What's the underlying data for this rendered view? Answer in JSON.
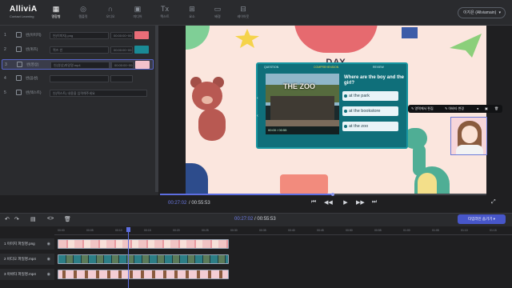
{
  "app": {
    "name": "AlliviA",
    "tagline": "Contact Learning"
  },
  "topnav": {
    "items": [
      {
        "icon": "card-icon",
        "label": "명함형",
        "active": true
      },
      {
        "icon": "shapes-icon",
        "label": "템플릿"
      },
      {
        "icon": "headphones-icon",
        "label": "오디오"
      },
      {
        "icon": "media-icon",
        "label": "미디어"
      },
      {
        "icon": "text-icon",
        "label": "텍스트"
      },
      {
        "icon": "grid-icon",
        "label": "요소"
      },
      {
        "icon": "background-icon",
        "label": "배경"
      },
      {
        "icon": "layout-icon",
        "label": "레이아웃"
      }
    ],
    "user": "이지은 (Allviamain)"
  },
  "scenes": [
    {
      "num": "1",
      "name": "씬(이미지)",
      "file": "씬(이미지).png",
      "file2": "00:00:00~00:00:00"
    },
    {
      "num": "2",
      "name": "씬(퀴즈)",
      "file": "퀴즈 씬",
      "file2": "00:00:00~00:00:00"
    },
    {
      "num": "3",
      "name": "씬(영상)",
      "file": "씬(영상)파일명.mp4",
      "file2": "00:00:00~00:00:55",
      "active": true
    },
    {
      "num": "4",
      "name": "씬(음성)",
      "file": "",
      "file2": ""
    },
    {
      "num": "5",
      "name": "씬(텍스트)",
      "file": "씬(텍스트) 내용을 입력해주세요",
      "file2": ""
    }
  ],
  "canvas": {
    "banner_day": "DAY",
    "quiz": {
      "tabs": [
        "QUESTION",
        "COMPREHENSION",
        "REVIEW"
      ],
      "video_sign": "THE ZOO",
      "video_time": "00:00 / 00:55",
      "question": "Where are the boy and the girl?",
      "answers": [
        "at the park",
        "at the bookstore",
        "at the zoo"
      ]
    },
    "element_toolbar": {
      "edit_label": "✎ 영역에서 편집",
      "replace_label": "✎ 아바타 변경"
    }
  },
  "player": {
    "current": "00:27:02",
    "total": "00:55:53",
    "progress": 0.53
  },
  "timeline": {
    "current": "00:27:02",
    "total": "00:55:53",
    "action_label": "타임라인 숨기기 ▾",
    "ruler": [
      "00:00",
      "00:05",
      "00:10",
      "00:15",
      "00:20",
      "00:25",
      "00:30",
      "00:35",
      "00:40",
      "00:45",
      "00:50",
      "00:55",
      "01:00",
      "01:05",
      "01:10",
      "01:15"
    ],
    "tracks": [
      {
        "label": "1 이미지 파일명.png",
        "kind": "image"
      },
      {
        "label": "2 비디오 파일명.mp4",
        "kind": "video"
      },
      {
        "label": "3 아바타 파일명.mp4",
        "kind": "avatar"
      }
    ]
  }
}
